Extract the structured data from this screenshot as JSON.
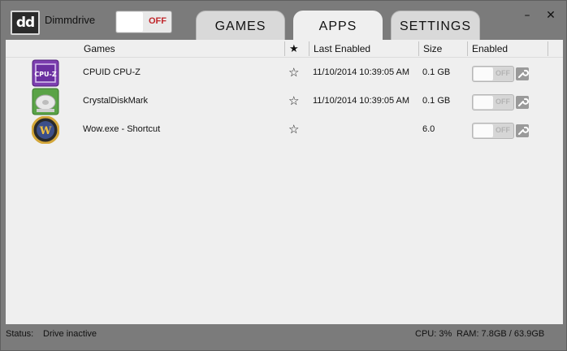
{
  "app": {
    "logo_text": "dd",
    "title": "Dimmdrive",
    "drive_toggle_label": "OFF"
  },
  "tabs": [
    {
      "label": "GAMES",
      "active": false
    },
    {
      "label": "APPS",
      "active": true
    },
    {
      "label": "SETTINGS",
      "active": false
    }
  ],
  "window_controls": {
    "minimize": "–",
    "close": "✕"
  },
  "table": {
    "headers": {
      "games": "Games",
      "star": "★",
      "last_enabled": "Last Enabled",
      "size": "Size",
      "enabled": "Enabled"
    },
    "rows": [
      {
        "icon": "cpuz-icon",
        "name": "CPUID CPU-Z",
        "star": "☆",
        "last_enabled": "11/10/2014 10:39:05 AM",
        "size": "0.1 GB",
        "toggle_label": "OFF"
      },
      {
        "icon": "crystaldiskmark-icon",
        "name": "CrystalDiskMark",
        "star": "☆",
        "last_enabled": "11/10/2014 10:39:05 AM",
        "size": "0.1 GB",
        "toggle_label": "OFF"
      },
      {
        "icon": "wow-icon",
        "name": "Wow.exe - Shortcut",
        "star": "☆",
        "last_enabled": "",
        "size": "6.0",
        "toggle_label": "OFF"
      }
    ]
  },
  "status": {
    "label": "Status:",
    "text": "Drive inactive",
    "cpu": "CPU: 3%",
    "ram": "RAM: 7.8GB / 63.9GB"
  },
  "colors": {
    "frame": "#7b7b7b",
    "panel": "#efefef",
    "off_red": "#c0262b",
    "cpuz_purple": "#7d3fb0",
    "wow_gold": "#d4a73a"
  }
}
